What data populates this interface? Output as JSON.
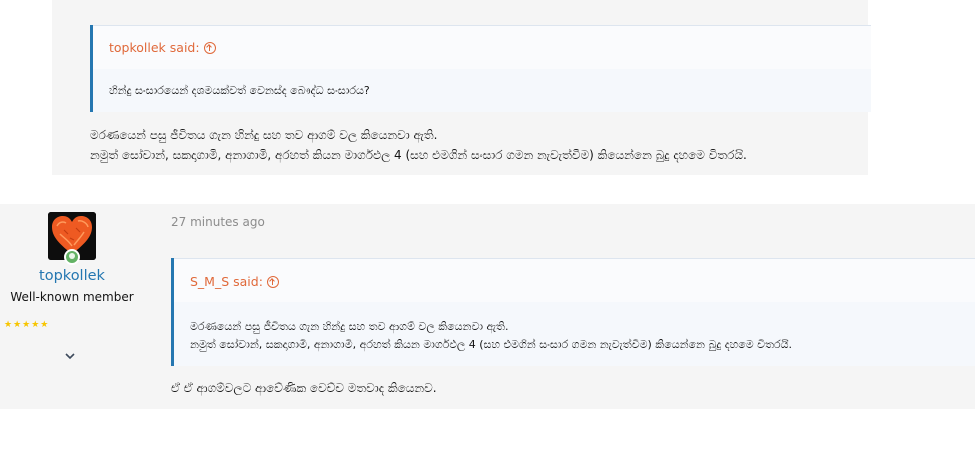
{
  "post1": {
    "quote": {
      "author_label": "topkollek said:",
      "text": "හින්දු සංසාරයෙන් දශමයක්වත් වෙනස්ද බෞද්ධ සංසාරය?"
    },
    "body_lines": [
      "මරණයෙන් පසු ජීවිතය ගැන හින්දු සහ තව ආගම් වල කියෙනවා ඇති.",
      "නමුත් සෝවාන්, සකදාගාමි, අනාගාමි, අරහත් කියන මාර්ගඵල 4 (සහ එමගින් සංසාර ගමන නැවැත්වීම) කියෙන්නෙ බුදු දහමෙ විතරයි."
    ]
  },
  "post2": {
    "user": {
      "name": "topkollek",
      "title": "Well-known member",
      "stars": "★★★★★",
      "avatar_icon": "heart-avatar-icon",
      "status_icon": "online-indicator-icon"
    },
    "time": "27 minutes ago",
    "quote": {
      "author_label": "S_M_S said:",
      "lines": [
        "මරණයෙන් පසු ජීවිතය ගැන හින්දු සහ තව ආගම් වල කියෙනවා ඇති.",
        "නමුත් සෝවාන්, සකදාගාමි, අනාගාමි, අරහත් කියන මාර්ගඵල 4 (සහ එමගින් සංසාර ගමන නැවැත්වීම) කියෙන්නෙ බුදු දහමෙ විතරයි."
      ]
    },
    "body": "ඒ ඒ ආගම්වලට ආවේණික වෙච්ච මතවාද කියෙනව."
  },
  "colors": {
    "accent_blue": "#2577b1",
    "quote_orange": "#e0693a",
    "star_gold": "#f7c500",
    "online_green": "#63b265"
  }
}
